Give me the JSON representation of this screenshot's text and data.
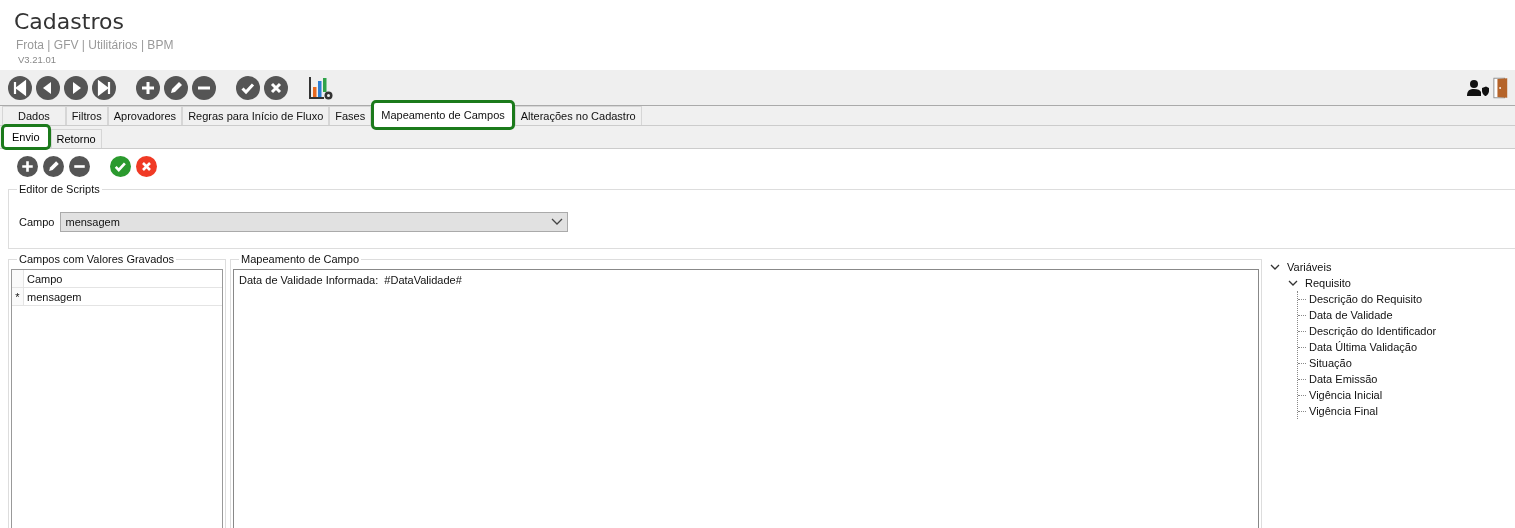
{
  "header": {
    "title": "Cadastros",
    "breadcrumb": "Frota | GFV | Utilitários | BPM",
    "version": "V3.21.01"
  },
  "tabs": [
    {
      "label": "Dados",
      "selected": false
    },
    {
      "label": "Filtros",
      "selected": false
    },
    {
      "label": "Aprovadores",
      "selected": false
    },
    {
      "label": "Regras para Início de Fluxo",
      "selected": false
    },
    {
      "label": "Fases",
      "selected": false
    },
    {
      "label": "Mapeamento de Campos",
      "selected": true
    },
    {
      "label": "Alterações no Cadastro",
      "selected": false
    }
  ],
  "subtabs": [
    {
      "label": "Envio",
      "selected": true
    },
    {
      "label": "Retorno",
      "selected": false
    }
  ],
  "editor": {
    "legend": "Editor de Scripts",
    "field_label": "Campo",
    "field_value": "mensagem"
  },
  "saved_fields": {
    "legend": "Campos com Valores Gravados",
    "column": "Campo",
    "rows": [
      {
        "marker": "*",
        "value": "mensagem"
      }
    ]
  },
  "mapping": {
    "legend": "Mapeamento de Campo",
    "text": "Data de Validade Informada:  #DataValidade#"
  },
  "variables": [
    {
      "label": "Variáveis",
      "expanded": true,
      "children": [
        {
          "label": "Requisito",
          "expanded": true,
          "children": [
            {
              "label": "Descrição do Requisito"
            },
            {
              "label": "Data de Validade"
            },
            {
              "label": "Descrição do Identificador"
            },
            {
              "label": "Data Última Validação"
            },
            {
              "label": "Situação"
            },
            {
              "label": "Data Emissão"
            },
            {
              "label": "Vigência Inicial"
            },
            {
              "label": "Vigência Final"
            }
          ]
        }
      ]
    }
  ]
}
